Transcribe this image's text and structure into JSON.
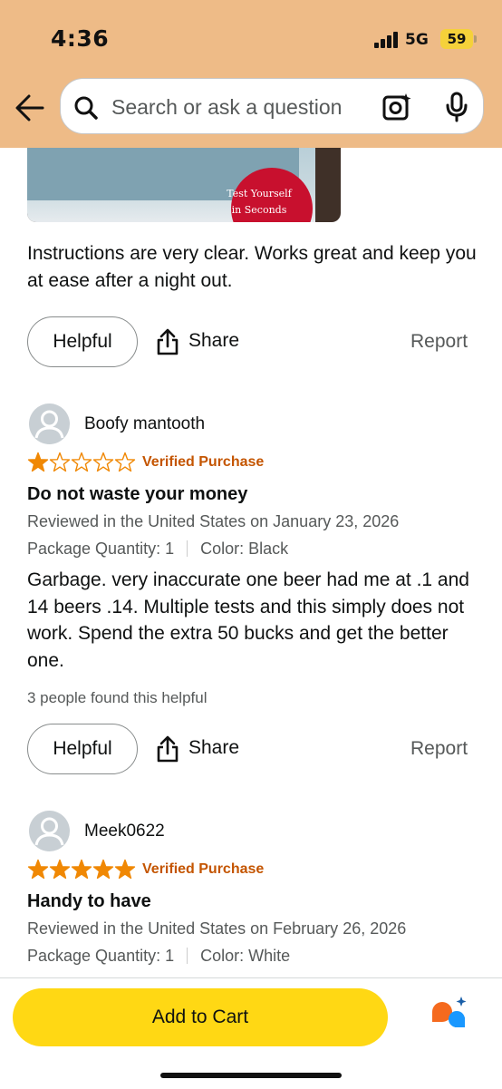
{
  "status_bar": {
    "time": "4:36",
    "network": "5G",
    "battery": "59"
  },
  "search": {
    "placeholder": "Search or ask a question"
  },
  "prev_review": {
    "image_sticker_line1": "Test Yourself",
    "image_sticker_line2": "in Seconds",
    "text": "Instructions are very clear. Works great and keep you at ease after a night out.",
    "helpful_label": "Helpful",
    "share_label": "Share",
    "report_label": "Report"
  },
  "reviews": [
    {
      "name": "Boofy mantooth",
      "rating": 1,
      "verified": "Verified Purchase",
      "title": "Do not waste your money",
      "date": "Reviewed in the United States on January 23, 2026",
      "package": "Package Quantity: 1",
      "color": "Color: Black",
      "text": "Garbage. very inaccurate one beer had me at .1 and 14 beers .14. Multiple tests and this simply does not work. Spend the extra 50 bucks and get the better one.",
      "helpful_count": "3 people found this helpful",
      "helpful_label": "Helpful",
      "share_label": "Share",
      "report_label": "Report"
    },
    {
      "name": "Meek0622",
      "rating": 5,
      "verified": "Verified Purchase",
      "title": "Handy to have",
      "date": "Reviewed in the United States on February 26, 2026",
      "package": "Package Quantity: 1",
      "color": "Color: White"
    }
  ],
  "bottom_bar": {
    "add_to_cart": "Add to Cart"
  },
  "colors": {
    "header": "#eebb87",
    "star": "#f08804",
    "verified": "#c45500",
    "cart_button": "#ffd814"
  }
}
